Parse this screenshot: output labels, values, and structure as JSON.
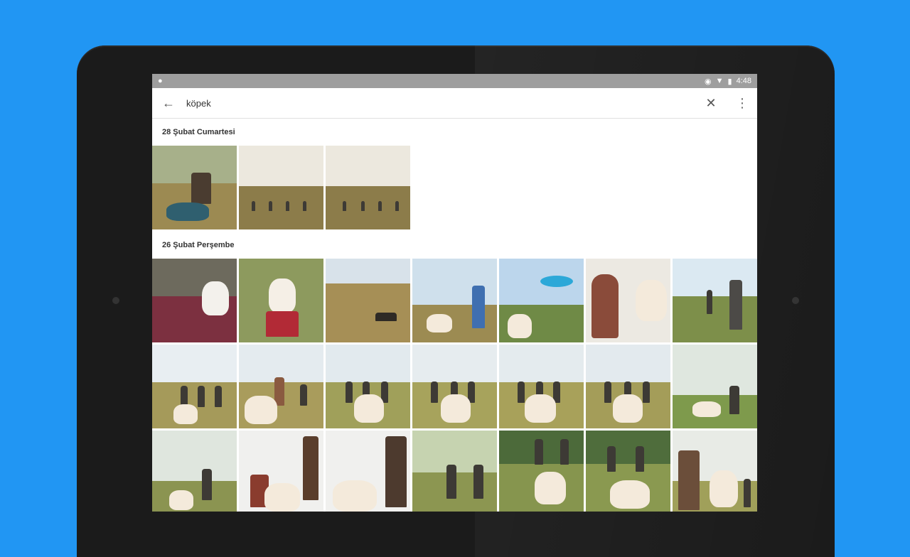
{
  "statusbar": {
    "time": "4:48"
  },
  "search": {
    "query": "köpek"
  },
  "sections": [
    {
      "title": "28 Şubat Cumartesi"
    },
    {
      "title": "26 Şubat Perşembe"
    }
  ],
  "colors": {
    "background": "#2196F3",
    "tablet_bezel": "#1b1b1b",
    "statusbar": "#9e9e9e"
  },
  "icons": {
    "back": "arrow-left",
    "clear": "close",
    "menu": "more-vert"
  }
}
